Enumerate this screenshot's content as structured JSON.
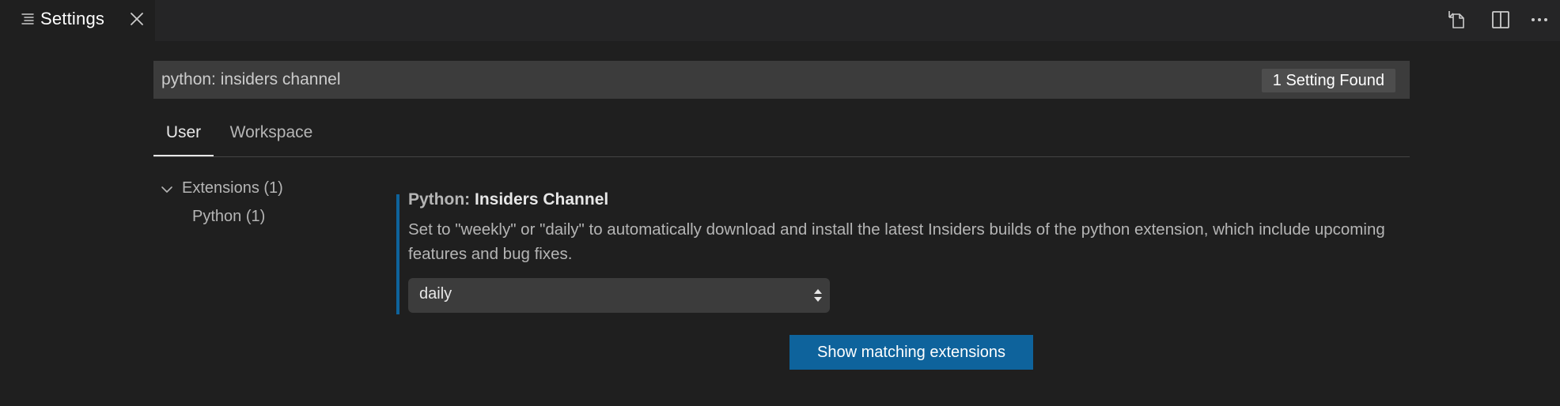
{
  "tab": {
    "label": "Settings",
    "icon": "settings-list-icon",
    "close_icon": "close-icon"
  },
  "editor_actions": [
    {
      "name": "open-settings-json",
      "icon": "open-json-icon"
    },
    {
      "name": "split-editor",
      "icon": "split-editor-icon"
    },
    {
      "name": "more-actions",
      "icon": "ellipsis-icon"
    }
  ],
  "search": {
    "value": "python: insiders channel",
    "result_count": "1 Setting Found"
  },
  "scope_tabs": {
    "user": "User",
    "workspace": "Workspace",
    "active": "User"
  },
  "toc": {
    "extensions": "Extensions (1)",
    "python": "Python (1)"
  },
  "setting": {
    "category": "Python: ",
    "name": "Insiders Channel",
    "description": "Set to \"weekly\" or \"daily\" to automatically download and install the latest Insiders builds of the python extension, which include upcoming features and bug fixes.",
    "value": "daily"
  },
  "show_extensions_button": "Show matching extensions",
  "colors": {
    "background": "#1f1f1f",
    "accent": "#0e639c",
    "input_background": "#3c3c3c"
  }
}
